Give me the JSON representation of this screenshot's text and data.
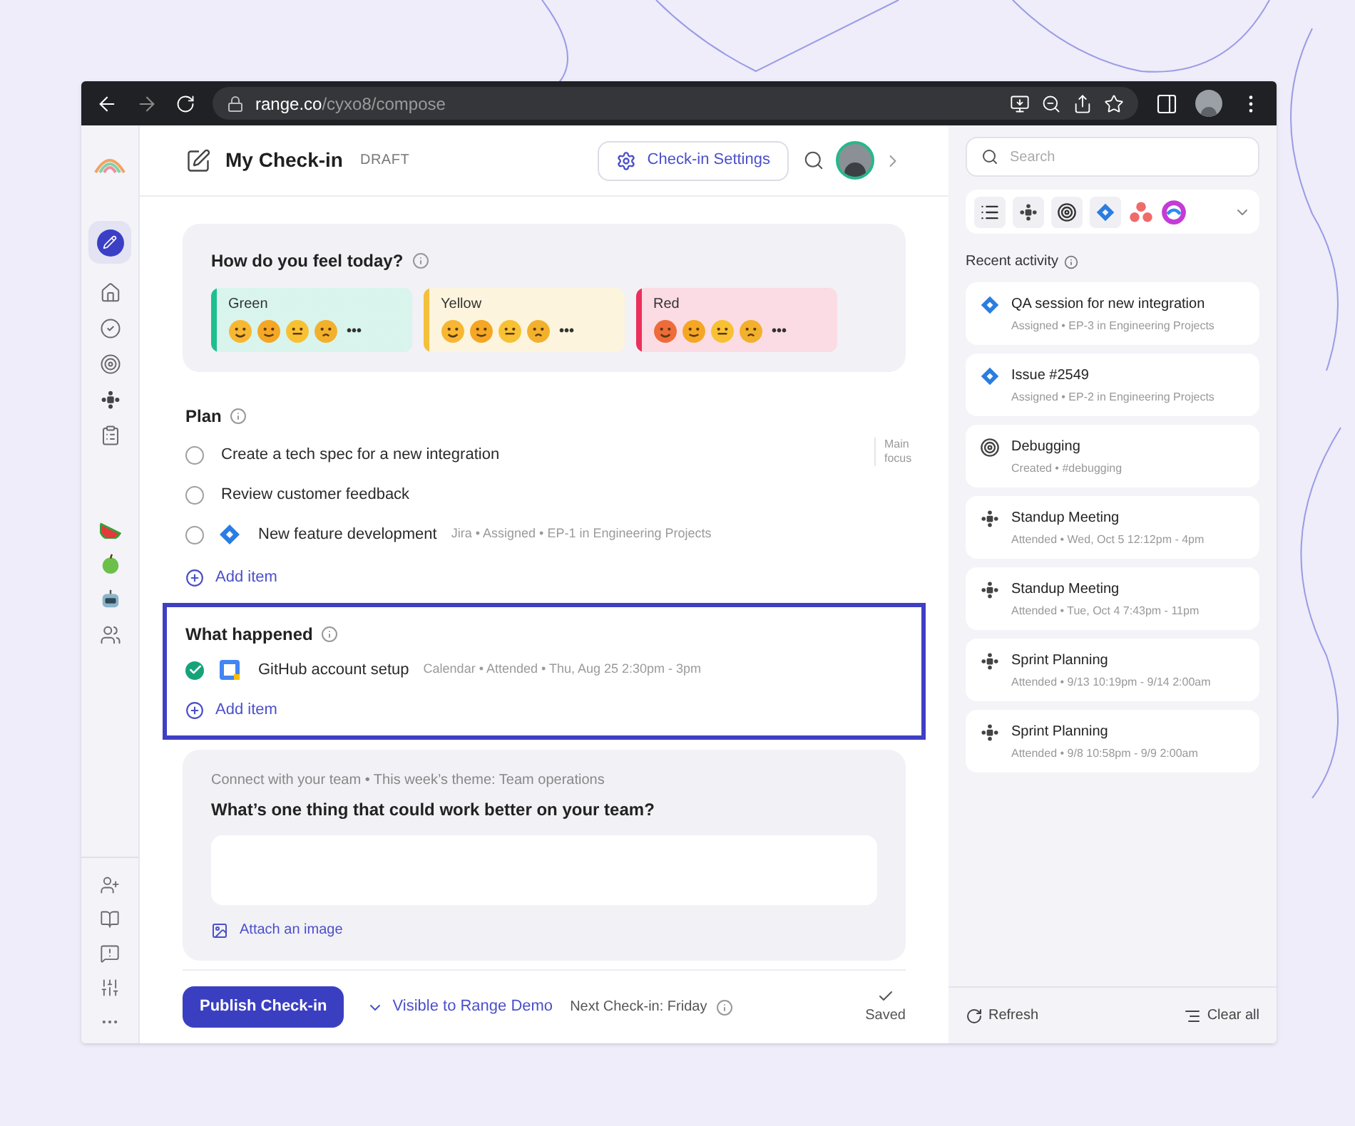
{
  "browser": {
    "url_host": "range.co",
    "url_path": "/cyxo8/compose"
  },
  "header": {
    "title": "My Check-in",
    "badge": "DRAFT",
    "settings_button": "Check-in Settings"
  },
  "mood": {
    "title": "How do you feel today?",
    "more": "•••",
    "options": [
      {
        "label": "Green",
        "color": "#1dbf8e"
      },
      {
        "label": "Yellow",
        "color": "#f4bf3a"
      },
      {
        "label": "Red",
        "color": "#ec2f5c"
      }
    ]
  },
  "plan": {
    "title": "Plan",
    "main_focus": "Main focus",
    "add_item": "Add item",
    "items": [
      {
        "kind": "task",
        "text": "Create a tech spec for a new integration",
        "checked": false
      },
      {
        "kind": "task",
        "text": "Review customer feedback",
        "checked": false
      },
      {
        "kind": "jira",
        "text": "New feature development",
        "meta": "Jira • Assigned • EP-1 in Engineering Projects",
        "checked": false
      }
    ]
  },
  "what_happened": {
    "title": "What happened",
    "highlighted": true,
    "add_item": "Add item",
    "items": [
      {
        "kind": "calendar",
        "text": "GitHub account setup",
        "meta": "Calendar • Attended • Thu, Aug 25 2:30pm - 3pm",
        "checked": true
      }
    ]
  },
  "prompt": {
    "eyebrow": "Connect with your team • This week’s theme: Team operations",
    "question": "What’s one thing that could work better on your team?",
    "attach": "Attach an image"
  },
  "footer": {
    "publish": "Publish Check-in",
    "visibility": "Visible to Range Demo",
    "next": "Next Check-in: Friday",
    "saved": "Saved"
  },
  "side": {
    "search_placeholder": "Search",
    "recent_title": "Recent activity",
    "refresh": "Refresh",
    "clear": "Clear all",
    "activity": [
      {
        "kind": "jira",
        "title": "QA session for new integration",
        "meta": "Assigned • EP-3 in Engineering Projects"
      },
      {
        "kind": "jira",
        "title": "Issue #2549",
        "meta": "Assigned • EP-2 in Engineering Projects"
      },
      {
        "kind": "goal",
        "title": "Debugging",
        "meta": "Created • #debugging"
      },
      {
        "kind": "meeting",
        "title": "Standup Meeting",
        "meta": "Attended • Wed, Oct 5 12:12pm - 4pm"
      },
      {
        "kind": "meeting",
        "title": "Standup Meeting",
        "meta": "Attended • Tue, Oct 4 7:43pm - 11pm"
      },
      {
        "kind": "meeting",
        "title": "Sprint Planning",
        "meta": "Attended • 9/13 10:19pm - 9/14 2:00am"
      },
      {
        "kind": "meeting",
        "title": "Sprint Planning",
        "meta": "Attended • 9/8 10:58pm - 9/9 2:00am"
      }
    ]
  }
}
